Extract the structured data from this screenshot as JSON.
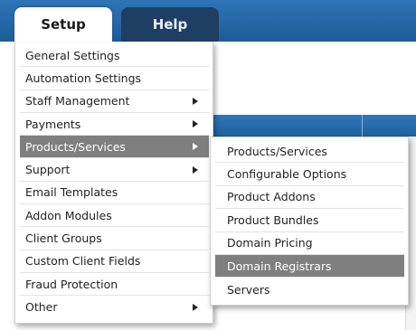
{
  "tabs": [
    {
      "label": "Setup",
      "active": true
    },
    {
      "label": "Help",
      "active": false
    }
  ],
  "colors": {
    "header_blue": "#2e74b6",
    "inactive_tab": "#1f3e63",
    "highlight": "#7f7f7f"
  },
  "setup_menu": {
    "items": [
      {
        "label": "General Settings",
        "has_submenu": false
      },
      {
        "label": "Automation Settings",
        "has_submenu": false
      },
      {
        "label": "Staff Management",
        "has_submenu": true
      },
      {
        "label": "Payments",
        "has_submenu": true
      },
      {
        "label": "Products/Services",
        "has_submenu": true,
        "highlighted": true
      },
      {
        "label": "Support",
        "has_submenu": true
      },
      {
        "label": "Email Templates",
        "has_submenu": false
      },
      {
        "label": "Addon Modules",
        "has_submenu": false
      },
      {
        "label": "Client Groups",
        "has_submenu": false
      },
      {
        "label": "Custom Client Fields",
        "has_submenu": false
      },
      {
        "label": "Fraud Protection",
        "has_submenu": false
      },
      {
        "label": "Other",
        "has_submenu": true
      }
    ]
  },
  "products_submenu": {
    "items": [
      {
        "label": "Products/Services"
      },
      {
        "label": "Configurable Options"
      },
      {
        "label": "Product Addons"
      },
      {
        "label": "Product Bundles"
      },
      {
        "label": "Domain Pricing"
      },
      {
        "label": "Domain Registrars",
        "highlighted": true
      },
      {
        "label": "Servers"
      }
    ]
  }
}
